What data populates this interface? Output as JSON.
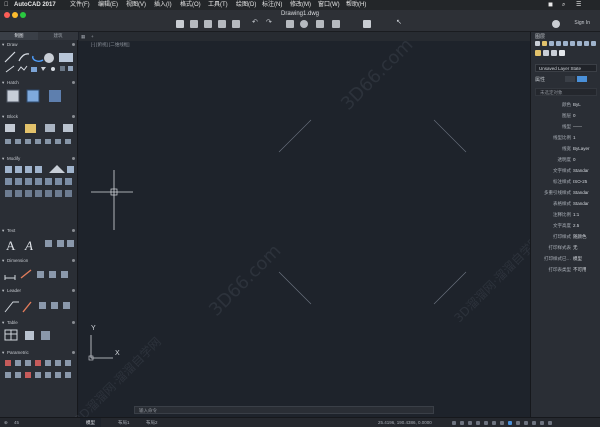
{
  "menubar": {
    "app_name": "AutoCAD 2017",
    "items": [
      "文件(F)",
      "编辑(E)",
      "视图(V)",
      "插入(I)",
      "格式(O)",
      "工具(T)",
      "绘图(D)",
      "标注(N)",
      "修改(M)",
      "窗口(W)",
      "帮助(H)"
    ]
  },
  "window": {
    "title": "Drawing1.dwg",
    "signin": "Sign In"
  },
  "left_panel": {
    "tabs": [
      "制图",
      "建筑"
    ],
    "sections": [
      "Draw",
      "Hatch",
      "Block",
      "Modify",
      "Text",
      "Dimension",
      "Leader",
      "Table",
      "Parametric"
    ]
  },
  "canvas": {
    "tab_add": "+",
    "view_label": "[-] [俯视] [二维线框]",
    "axis_y": "Y",
    "axis_x": "X",
    "command_placeholder": "输入命令",
    "background": "#1e232b"
  },
  "right_panel": {
    "layers_title": "图层",
    "layer_state": "Unsaved Layer State",
    "props_title": "属性",
    "props_sub": "未选定对象",
    "properties": [
      {
        "k": "颜色",
        "v": "ByL"
      },
      {
        "k": "图层",
        "v": "0"
      },
      {
        "k": "线型",
        "v": "——"
      },
      {
        "k": "线型比例",
        "v": "1"
      },
      {
        "k": "线宽",
        "v": "ByLayer"
      },
      {
        "k": "透明度",
        "v": "0"
      },
      {
        "k": "文字样式",
        "v": "Standar"
      },
      {
        "k": "标注样式",
        "v": "ISO-25"
      },
      {
        "k": "多重引线样式",
        "v": "Standar"
      },
      {
        "k": "表格样式",
        "v": "Standar"
      },
      {
        "k": "注释比例",
        "v": "1:1"
      },
      {
        "k": "文字高度",
        "v": "2.5"
      },
      {
        "k": "打印样式",
        "v": "随颜色"
      },
      {
        "k": "打印样式表",
        "v": "无"
      },
      {
        "k": "打印样式已…",
        "v": "模型"
      },
      {
        "k": "打印表类型",
        "v": "不可用"
      }
    ]
  },
  "statusbar": {
    "zoom": "45",
    "tabs": [
      "模型",
      "布局1",
      "布局2"
    ],
    "coords": "25.4196, 190.4386, 0.0000"
  },
  "watermarks": [
    "3D66.com",
    "3D66.com",
    "3D溜溜网·溜溜自学网",
    "3D溜溜网·溜溜自学网"
  ],
  "colors": {
    "close": "#fc5e57",
    "minimize": "#fdbc2e",
    "maximize": "#2ac840",
    "accent": "#4a90d9"
  }
}
